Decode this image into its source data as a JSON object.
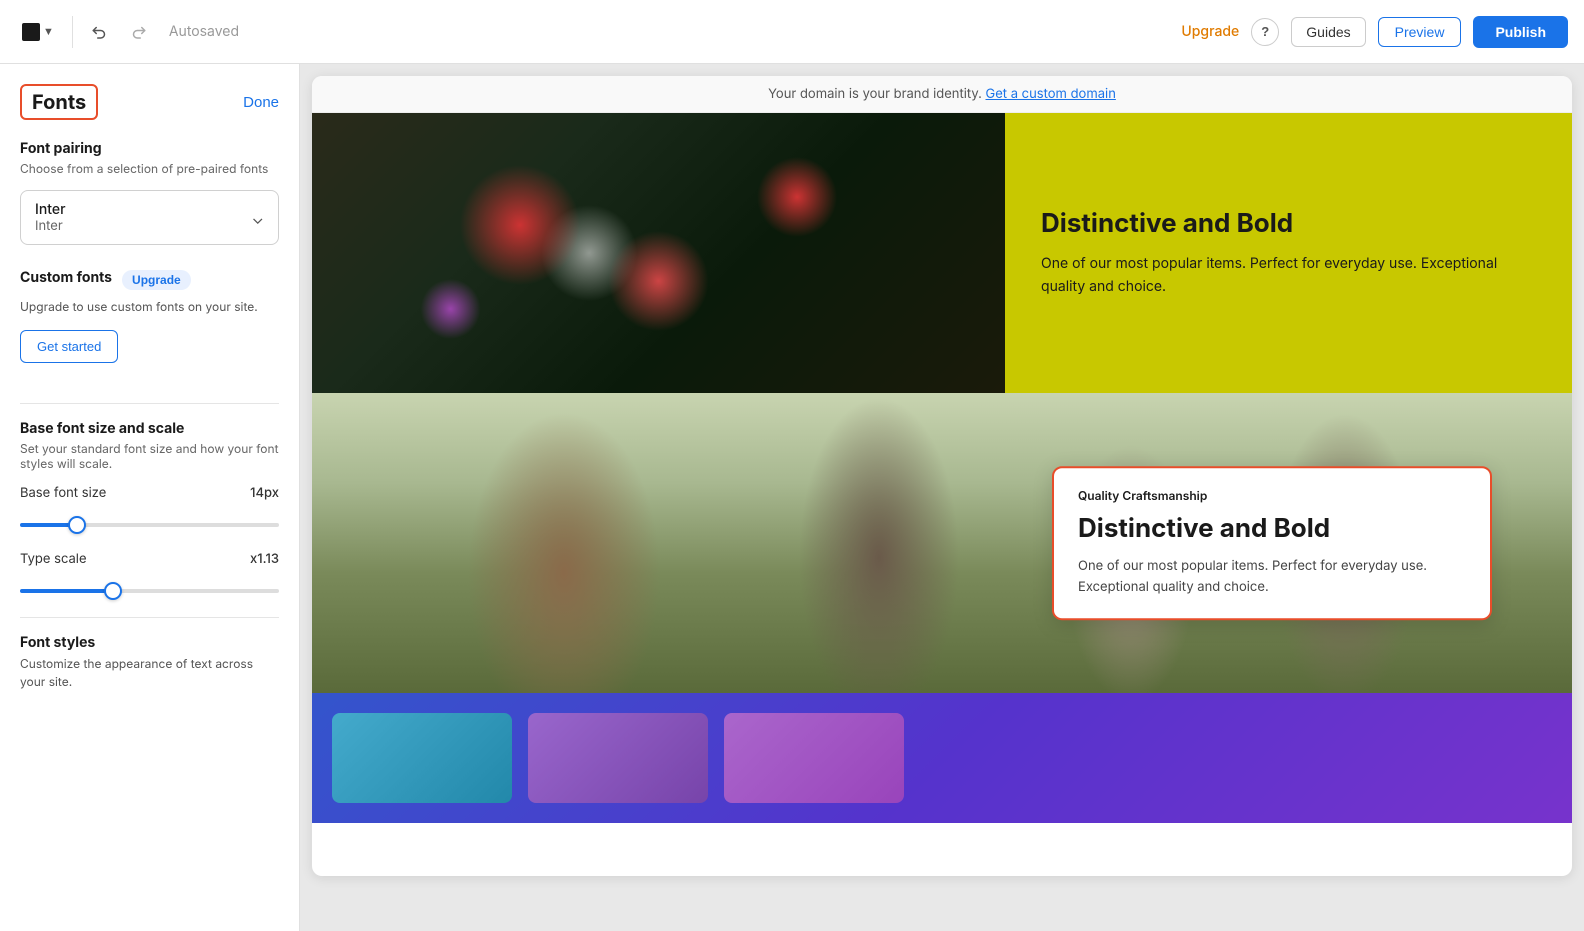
{
  "toolbar": {
    "autosaved": "Autosaved",
    "upgrade_label": "Upgrade",
    "help_icon": "?",
    "guides_label": "Guides",
    "preview_label": "Preview",
    "publish_label": "Publish"
  },
  "left_panel": {
    "title": "Fonts",
    "done_label": "Done",
    "font_pairing": {
      "label": "Font pairing",
      "description": "Choose from a selection of pre-paired fonts",
      "primary_font": "Inter",
      "secondary_font": "Inter"
    },
    "custom_fonts": {
      "label": "Custom fonts",
      "upgrade_badge": "Upgrade",
      "description": "Upgrade to use custom fonts on your site.",
      "get_started_label": "Get started"
    },
    "base_font": {
      "section_label": "Base font size and scale",
      "description": "Set your standard font size and how your font styles will scale.",
      "size_label": "Base font size",
      "size_value": "14px",
      "size_slider_val": "20",
      "scale_label": "Type scale",
      "scale_value": "x1.13",
      "scale_slider_val": "35"
    },
    "font_styles": {
      "label": "Font styles",
      "description": "Customize the appearance of text across your site."
    }
  },
  "canvas": {
    "domain_banner": "Your domain is your brand identity.",
    "domain_link": "Get a custom domain",
    "section1": {
      "heading": "Distinctive and Bold",
      "body": "One of our most popular items. Perfect for everyday use. Exceptional quality and choice."
    },
    "section2_card": {
      "badge": "Quality Craftsmanship",
      "heading": "Distinctive and Bold",
      "body": "One of our most popular items. Perfect for everyday use. Exceptional quality and choice."
    }
  }
}
